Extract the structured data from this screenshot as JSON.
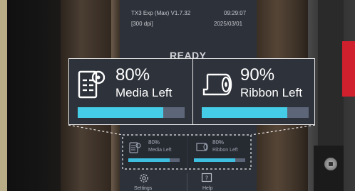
{
  "device": {
    "model": "TX3 Exp (Max) V1.7.32",
    "dpi": "[300 dpi]",
    "time": "09:29:07",
    "date": "2025/03/01",
    "status": "READY"
  },
  "supplies": {
    "media": {
      "percent_label": "80%",
      "label": "Media Left",
      "level": 0.8
    },
    "ribbon": {
      "percent_label": "90%",
      "label": "Ribbon Left",
      "level": 0.8
    }
  },
  "mini": {
    "media": {
      "percent_label": "80%",
      "label": "Media Left"
    },
    "ribbon": {
      "percent_label": "80%",
      "label": "Ribbon Left"
    }
  },
  "menu": {
    "settings": "Settings",
    "help": "Help"
  },
  "colors": {
    "accent": "#45cde8",
    "bar_bg": "#5d6679",
    "panel": "#2e323a",
    "chassis_red": "#d0202e"
  }
}
